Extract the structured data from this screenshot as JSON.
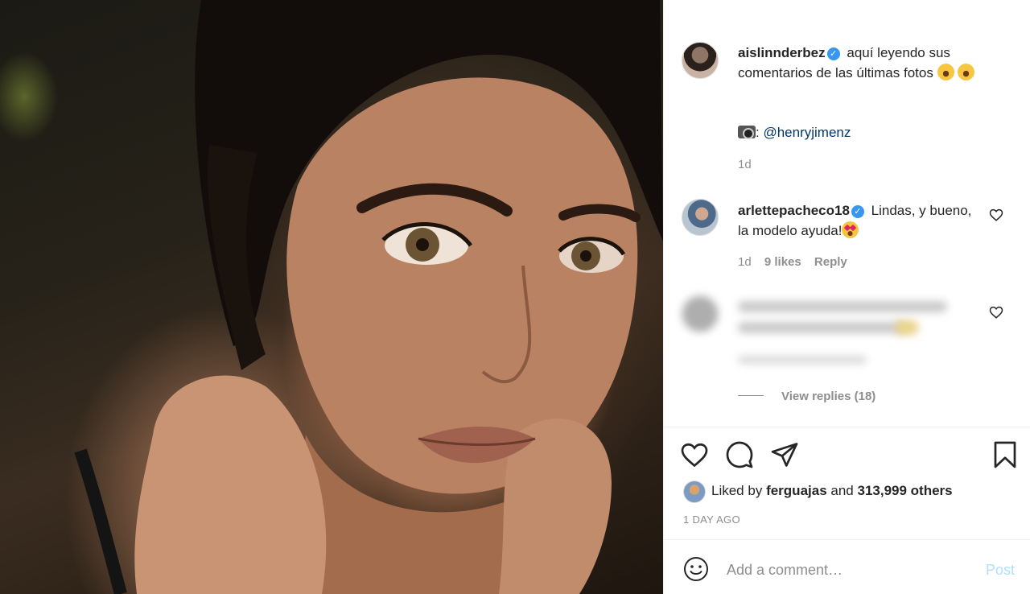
{
  "post": {
    "author": "aislinnderbez",
    "caption": "aquí leyendo sus comentarios de las últimas fotos",
    "credit_mention": "@henryjimenz",
    "age": "1d"
  },
  "comments": [
    {
      "username": "arlettepacheco18",
      "text": "Lindas, y bueno, la modelo ayuda!",
      "age": "1d",
      "likes": "9 likes",
      "reply_label": "Reply"
    }
  ],
  "view_replies": "View replies (18)",
  "likes": {
    "prefix": "Liked by",
    "user": "ferguajas",
    "connector": "and",
    "others": "313,999 others"
  },
  "timestamp": "1 DAY AGO",
  "add_comment": {
    "placeholder": "Add a comment…",
    "post_label": "Post"
  },
  "colors": {
    "verified": "#3897f0",
    "mention": "#00376b",
    "post_disabled": "#b2dffc"
  }
}
